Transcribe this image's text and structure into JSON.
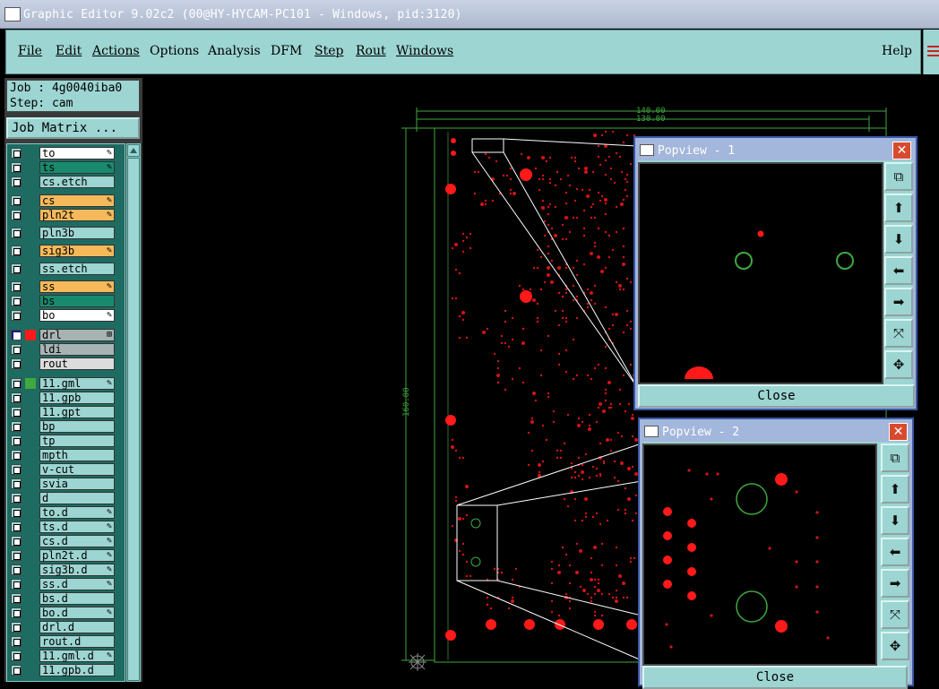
{
  "window": {
    "title": "Graphic Editor 9.02c2 (00@HY-HYCAM-PC101 - Windows, pid:3120)"
  },
  "menu": {
    "items": [
      "File",
      "Edit",
      "Actions",
      "Options",
      "Analysis",
      "DFM",
      "Step",
      "Rout",
      "Windows"
    ],
    "help": "Help"
  },
  "job": {
    "job_line": "Job : 4g0040iba0",
    "step_line": "Step: cam",
    "matrix_label": "Job Matrix ..."
  },
  "colors": {
    "teal": "#9cd5d2",
    "dark_teal": "#1e6b62",
    "green_layer": "#1a8a6e",
    "orange_layer": "#f5b95a",
    "gray_layer": "#a7b4b3",
    "pad_red": "#ff1a1a",
    "outline_green": "#3fa83f",
    "title_blue": "#3a58a8"
  },
  "layers": [
    {
      "name": "to",
      "color": "white",
      "mark": "✎"
    },
    {
      "name": "ts",
      "color": "green",
      "mark": "✎"
    },
    {
      "name": "cs.etch",
      "color": "teal",
      "mark": ""
    },
    {
      "name": "cs",
      "color": "orange",
      "mark": "✎"
    },
    {
      "name": "pln2t",
      "color": "orange",
      "mark": "✎"
    },
    {
      "name": "pln3b",
      "color": "teal",
      "mark": ""
    },
    {
      "name": "sig3b",
      "color": "orange",
      "mark": "✎"
    },
    {
      "name": "ss.etch",
      "color": "teal",
      "mark": ""
    },
    {
      "name": "ss",
      "color": "orange",
      "mark": "✎"
    },
    {
      "name": "bs",
      "color": "green",
      "mark": ""
    },
    {
      "name": "bo",
      "color": "white",
      "mark": "✎"
    },
    {
      "name": "drl",
      "color": "gray",
      "mark": "⊞",
      "selected": true,
      "swatch": "#ff1a1a"
    },
    {
      "name": "ldi",
      "color": "gray",
      "mark": ""
    },
    {
      "name": "rout",
      "color": "lightgray",
      "mark": ""
    },
    {
      "name": "11.gml",
      "color": "teal",
      "mark": "✎",
      "swatch": "#3fa83f"
    },
    {
      "name": "11.gpb",
      "color": "teal",
      "mark": ""
    },
    {
      "name": "11.gpt",
      "color": "teal",
      "mark": ""
    },
    {
      "name": "bp",
      "color": "teal",
      "mark": ""
    },
    {
      "name": "tp",
      "color": "teal",
      "mark": ""
    },
    {
      "name": "mpth",
      "color": "teal",
      "mark": ""
    },
    {
      "name": "v-cut",
      "color": "teal",
      "mark": ""
    },
    {
      "name": "svia",
      "color": "teal",
      "mark": ""
    },
    {
      "name": "d",
      "color": "teal",
      "mark": ""
    },
    {
      "name": "to.d",
      "color": "teal",
      "mark": "✎"
    },
    {
      "name": "ts.d",
      "color": "teal",
      "mark": "✎"
    },
    {
      "name": "cs.d",
      "color": "teal",
      "mark": "✎"
    },
    {
      "name": "pln2t.d",
      "color": "teal",
      "mark": "✎"
    },
    {
      "name": "sig3b.d",
      "color": "teal",
      "mark": "✎"
    },
    {
      "name": "ss.d",
      "color": "teal",
      "mark": "✎"
    },
    {
      "name": "bs.d",
      "color": "teal",
      "mark": ""
    },
    {
      "name": "bo.d",
      "color": "teal",
      "mark": "✎"
    },
    {
      "name": "drl.d",
      "color": "teal",
      "mark": ""
    },
    {
      "name": "rout.d",
      "color": "teal",
      "mark": ""
    },
    {
      "name": "11.gml.d",
      "color": "teal",
      "mark": "✎"
    },
    {
      "name": "11.gpb.d",
      "color": "teal",
      "mark": ""
    }
  ],
  "dimensions": {
    "outer_width": "140.00",
    "inner_width": "130.00",
    "height": "160.00"
  },
  "popview1": {
    "title": "Popview - 1",
    "close_label": "Close"
  },
  "popview2": {
    "title": "Popview - 2",
    "close_label": "Close"
  },
  "toolbar_icons": [
    "zoom-window-icon",
    "move-up-icon",
    "move-down-icon",
    "move-left-icon",
    "move-right-icon",
    "zoom-fit-icon",
    "pan-center-icon"
  ]
}
